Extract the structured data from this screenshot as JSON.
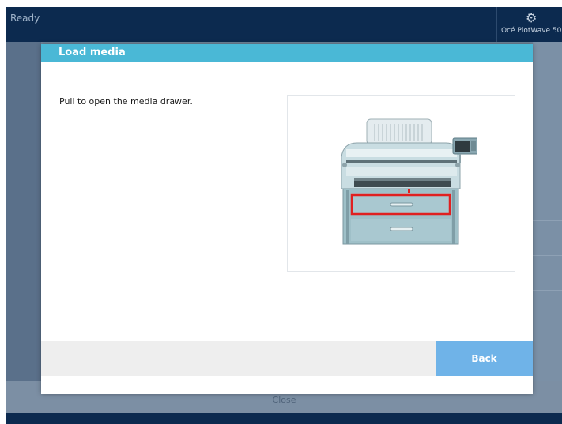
{
  "topbar": {
    "status": "Ready",
    "device_icon": "gear-icon",
    "device_name": "Océ PlotWave 50("
  },
  "background": {
    "close_label": "Close"
  },
  "dialog": {
    "title": "Load media",
    "instruction": "Pull to open the media drawer.",
    "illustration": "printer-with-highlighted-media-drawer",
    "back_label": "Back"
  },
  "colors": {
    "topbar": "#0c2a4f",
    "dialog_header": "#4ab8d6",
    "back_button": "#6fb3e8",
    "highlight": "#e02020"
  }
}
